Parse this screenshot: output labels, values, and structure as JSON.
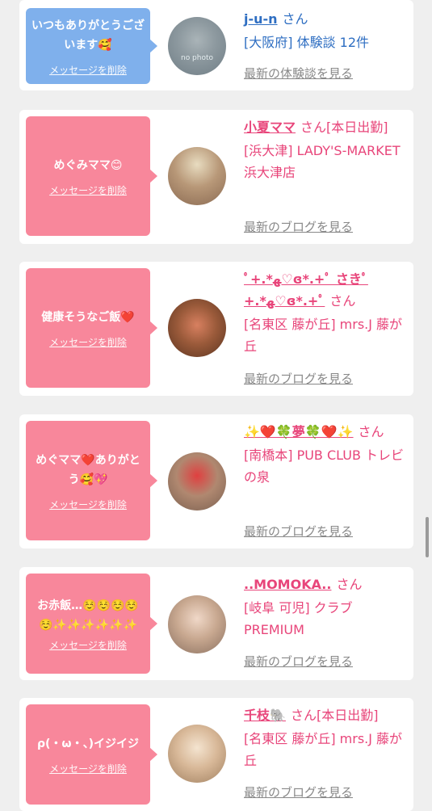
{
  "colors": {
    "pink": "#f8879b",
    "blue": "#7fb0ec",
    "name_pink": "#e8457a",
    "name_blue": "#2e6ec2"
  },
  "delete_label": "メッセージを削除",
  "san": "さん",
  "cards": [
    {
      "message": "いつもありがとうございます🥰",
      "name": "j-u-n",
      "status": "",
      "shop": "[大阪府] 体験談 12件",
      "link": "最新の体験談を見る",
      "avatar_text": "no photo",
      "theme": "blue"
    },
    {
      "message": "めぐみママ😊",
      "name": "小夏ママ",
      "status": "[本日出勤]",
      "shop": "[浜大津] LADY'S-MARKET 浜大津店",
      "link": "最新のブログを見る",
      "theme": "pink"
    },
    {
      "message": "健康そうなご飯❤️",
      "name": "ﾟ+.*ﻬ♡ɞ*.+ﾟ さきﾟ+.*ﻬ♡ɞ*.+ﾟ",
      "status": "",
      "shop": "[名東区 藤が丘] mrs.J 藤が丘",
      "link": "最新のブログを見る",
      "theme": "pink"
    },
    {
      "message": "めぐママ❤️ありがとう🥰💖",
      "name": "✨❤️🍀夢🍀❤️✨",
      "status": "",
      "shop": "[南橋本] PUB CLUB トレビの泉",
      "link": "最新のブログを見る",
      "theme": "pink"
    },
    {
      "message": "お赤飯…☺️☺️☺️☺️☺️✨✨✨✨✨✨",
      "name": "..MOMOKA..",
      "status": "",
      "shop": "[岐阜 可児] クラブ PREMIUM",
      "link": "最新のブログを見る",
      "theme": "pink"
    },
    {
      "message": "ρ(・ω・、)イジイジ",
      "name": "千枝🐘",
      "status": "[本日出勤]",
      "shop": "[名東区 藤が丘] mrs.J 藤が丘",
      "link": "最新のブログを見る",
      "theme": "pink"
    }
  ]
}
